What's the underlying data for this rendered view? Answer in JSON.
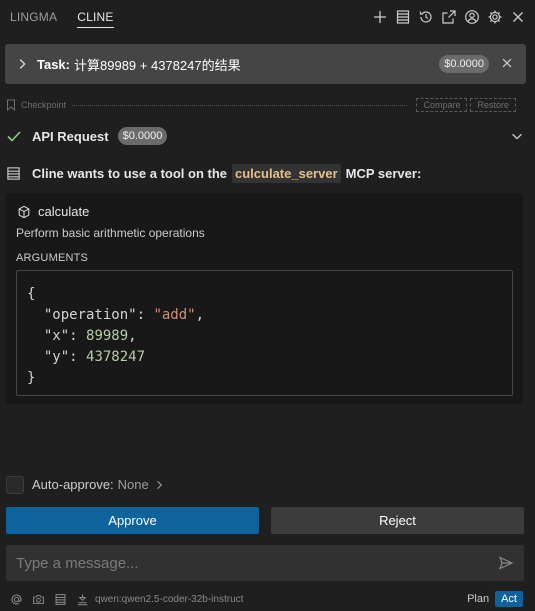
{
  "tabs": [
    "LINGMA",
    "CLINE"
  ],
  "active_tab": "CLINE",
  "top_icons": [
    "plus-icon",
    "server-icon",
    "history-icon",
    "popout-icon",
    "account-icon",
    "settings-icon",
    "close-icon"
  ],
  "task": {
    "label": "Task:",
    "text": "计算89989 + 4378247的结果",
    "cost": "$0.0000"
  },
  "checkpoint": {
    "label": "Checkpoint",
    "compare": "Compare",
    "restore": "Restore"
  },
  "api_request": {
    "label": "API Request",
    "cost": "$0.0000"
  },
  "mcp": {
    "prefix": "Cline wants to use a tool on the",
    "server": "culculate_server",
    "suffix": "MCP server:"
  },
  "tool": {
    "name": "calculate",
    "description": "Perform basic arithmetic operations",
    "args_label": "ARGUMENTS",
    "code": {
      "open": "{",
      "operation_key": "\"operation\"",
      "operation_value": "\"add\"",
      "x_key": "\"x\"",
      "x_value": "89989",
      "y_key": "\"y\"",
      "y_value": "4378247",
      "close": "}"
    }
  },
  "auto_approve": {
    "label": "Auto-approve:",
    "value": "None"
  },
  "buttons": {
    "approve": "Approve",
    "reject": "Reject"
  },
  "input": {
    "placeholder": "Type a message..."
  },
  "footer": {
    "model": "qwen:qwen2.5-coder-32b-instruct",
    "plan": "Plan",
    "act": "Act",
    "active_mode": "Act"
  },
  "colors": {
    "approve": "#0e639c",
    "reject": "#3c3c3c",
    "server_name": "#e2c08d",
    "check": "#89d185"
  }
}
